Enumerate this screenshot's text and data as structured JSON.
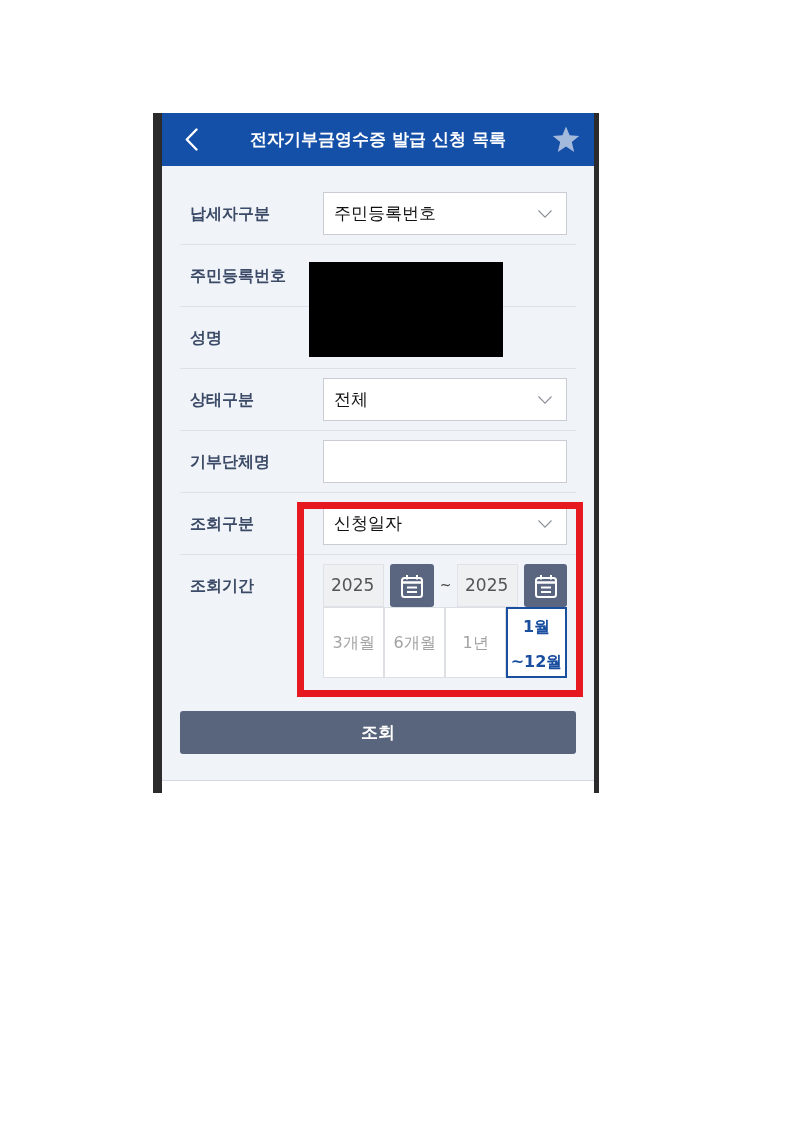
{
  "header": {
    "title": "전자기부금영수증 발급 신청 목록"
  },
  "form": {
    "rows": [
      {
        "kind": "select",
        "label": "납세자구분",
        "value": "주민등록번호",
        "masked": false,
        "highlighted": false
      },
      {
        "kind": "static",
        "label": "주민등록번호",
        "masked": true,
        "highlighted": false
      },
      {
        "kind": "static",
        "label": "성명",
        "masked": true,
        "highlighted": false
      },
      {
        "kind": "select",
        "label": "상태구분",
        "value": "전체",
        "masked": false,
        "highlighted": false
      },
      {
        "kind": "input",
        "label": "기부단체명",
        "masked": false,
        "highlighted": false
      },
      {
        "kind": "select",
        "label": "조회구분",
        "value": "신청일자",
        "masked": false,
        "highlighted": true
      },
      {
        "kind": "period",
        "label": "조회기간",
        "from": "2025",
        "separator": "~",
        "to": "2025",
        "masked": false,
        "highlighted": true,
        "presets": [
          {
            "label": "3개월",
            "selected": false
          },
          {
            "label": "6개월",
            "selected": false
          },
          {
            "label": "1년",
            "selected": false
          },
          {
            "label": "1월 ~12월",
            "selected": true
          }
        ]
      }
    ]
  },
  "search_button": {
    "label": "조회"
  }
}
